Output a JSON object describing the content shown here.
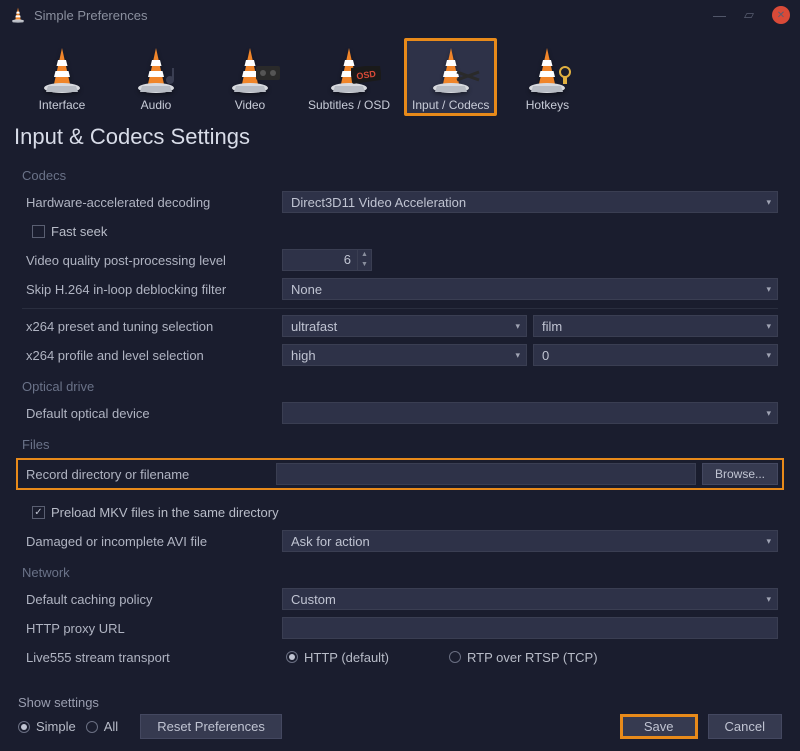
{
  "window": {
    "title": "Simple Preferences"
  },
  "tabs": [
    {
      "label": "Interface"
    },
    {
      "label": "Audio"
    },
    {
      "label": "Video"
    },
    {
      "label": "Subtitles / OSD"
    },
    {
      "label": "Input / Codecs"
    },
    {
      "label": "Hotkeys"
    }
  ],
  "page": {
    "title": "Input & Codecs Settings"
  },
  "sections": {
    "codecs": {
      "header": "Codecs",
      "hw_label": "Hardware-accelerated decoding",
      "hw_value": "Direct3D11 Video Acceleration",
      "fast_seek_label": "Fast seek",
      "fast_seek_checked": false,
      "quality_label": "Video quality post-processing level",
      "quality_value": "6",
      "skip_label": "Skip H.264 in-loop deblocking filter",
      "skip_value": "None",
      "x264preset_label": "x264 preset and tuning selection",
      "x264preset_value": "ultrafast",
      "x264tuning_value": "film",
      "x264profile_label": "x264 profile and level selection",
      "x264profile_value": "high",
      "x264level_value": "0"
    },
    "optical": {
      "header": "Optical drive",
      "device_label": "Default optical device",
      "device_value": ""
    },
    "files": {
      "header": "Files",
      "record_label": "Record directory or filename",
      "record_value": "",
      "browse_label": "Browse...",
      "preload_label": "Preload MKV files in the same directory",
      "preload_checked": true,
      "avi_label": "Damaged or incomplete AVI file",
      "avi_value": "Ask for action"
    },
    "network": {
      "header": "Network",
      "caching_label": "Default caching policy",
      "caching_value": "Custom",
      "proxy_label": "HTTP proxy URL",
      "proxy_value": "",
      "live555_label": "Live555 stream transport",
      "radio_http": "HTTP (default)",
      "radio_rtsp": "RTP over RTSP (TCP)"
    }
  },
  "footer": {
    "show_label": "Show settings",
    "radio_simple": "Simple",
    "radio_all": "All",
    "reset_label": "Reset Preferences",
    "save_label": "Save",
    "cancel_label": "Cancel"
  }
}
